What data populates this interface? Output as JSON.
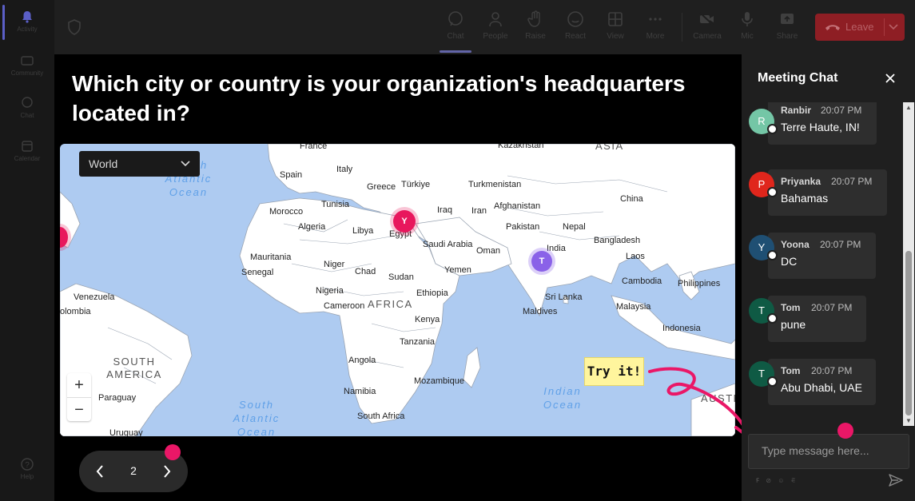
{
  "rail": {
    "items": [
      {
        "label": "Activity",
        "icon": "bell-icon"
      },
      {
        "label": "Community",
        "icon": "community-icon"
      },
      {
        "label": "Chat",
        "icon": "chat-icon"
      },
      {
        "label": "Calendar",
        "icon": "calendar-icon"
      },
      {
        "label": "Help",
        "icon": "help-icon"
      }
    ]
  },
  "toolbar": {
    "buttons": [
      {
        "label": "Chat",
        "icon": "chat-icon"
      },
      {
        "label": "People",
        "icon": "people-icon"
      },
      {
        "label": "Raise",
        "icon": "hand-icon"
      },
      {
        "label": "React",
        "icon": "smile-icon"
      },
      {
        "label": "View",
        "icon": "grid-icon"
      },
      {
        "label": "More",
        "icon": "more-icon"
      },
      {
        "label": "Camera",
        "icon": "camera-off-icon"
      },
      {
        "label": "Mic",
        "icon": "mic-icon"
      },
      {
        "label": "Share",
        "icon": "share-icon"
      }
    ],
    "leave_label": "Leave",
    "leave_color": "#8e1e24"
  },
  "question": "Which city or country is your organization's headquarters located in?",
  "map": {
    "region_select": "World",
    "labels": {
      "france": "France",
      "kazakhstan": "Kazakhstan",
      "asia": "ASIA",
      "spain": "Spain",
      "italy": "Italy",
      "greece": "Greece",
      "turkiye": "Türkiye",
      "turkmenistan": "Turkmenistan",
      "china": "China",
      "morocco": "Morocco",
      "tunisia": "Tunisia",
      "iraq": "Iraq",
      "iran": "Iran",
      "afghanistan": "Afghanistan",
      "algeria": "Algeria",
      "libya": "Libya",
      "egypt": "Egypt",
      "pakistan": "Pakistan",
      "nepal": "Nepal",
      "saudi": "Saudi Arabia",
      "bangladesh": "Bangladesh",
      "oman": "Oman",
      "india": "India",
      "mauritania": "Mauritania",
      "niger": "Niger",
      "laos": "Laos",
      "senegal": "Senegal",
      "chad": "Chad",
      "sudan": "Sudan",
      "yemen": "Yemen",
      "cambodia": "Cambodia",
      "philippines": "Philippines",
      "nigeria": "Nigeria",
      "ethiopia": "Ethiopia",
      "venezuela": "Venezuela",
      "srilanka": "Sri Lanka",
      "cameroon": "Cameroon",
      "africa": "AFRICA",
      "malaysia": "Malaysia",
      "colombia": "olombia",
      "maldives": "Maldives",
      "kenya": "Kenya",
      "indonesia": "Indonesia",
      "tanzania": "Tanzania",
      "southamerica": "SOUTH AMERICA",
      "angola": "Angola",
      "mozambique": "Mozambique",
      "paraguay": "Paraguay",
      "namibia": "Namibia",
      "southafrica": "South Africa",
      "uruguay": "Uruguay",
      "australia": "AUSTR",
      "atlantic": "Atlantic Ocean",
      "southatlantic": "South Atlantic Ocean",
      "indian": "Indian Ocean",
      "h": "h"
    },
    "pins": [
      {
        "letter": "Y",
        "color": "#e8175d"
      },
      {
        "letter": "T",
        "color": "#8a62e8"
      },
      {
        "letter": "",
        "color": "#e8175d"
      }
    ],
    "zoom_in": "+",
    "zoom_out": "−",
    "try_it": "Try it!"
  },
  "pager": {
    "page": "2"
  },
  "chat": {
    "title": "Meeting Chat",
    "messages": [
      {
        "initial": "R",
        "name": "Ranbir",
        "time": "20:07 PM",
        "text": "Terre Haute, IN!",
        "color": "#74c6a6"
      },
      {
        "initial": "P",
        "name": "Priyanka",
        "time": "20:07 PM",
        "text": "Bahamas",
        "color": "#e0261c"
      },
      {
        "initial": "Y",
        "name": "Yoona",
        "time": "20:07 PM",
        "text": "DC",
        "color": "#1f4f73"
      },
      {
        "initial": "T",
        "name": "Tom",
        "time": "20:07 PM",
        "text": "pune",
        "color": "#0f5a44"
      },
      {
        "initial": "T",
        "name": "Tom",
        "time": "20:07 PM",
        "text": "Abu Dhabi, UAE",
        "color": "#0f5a44"
      }
    ],
    "placeholder": "Type message here...",
    "format_icons": "Ꞙ ⊘ ☺ ⋷"
  },
  "accent": "#ea1767"
}
